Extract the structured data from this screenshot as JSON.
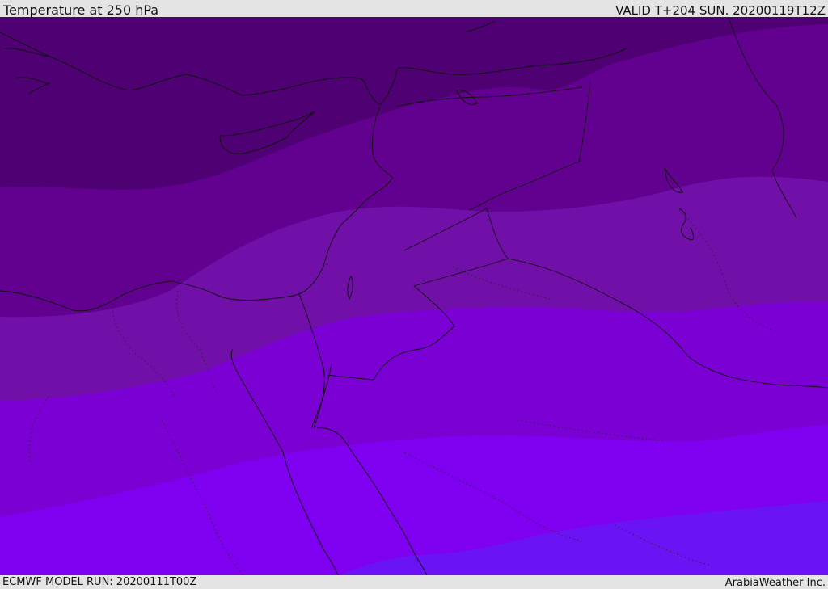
{
  "header": {
    "title": "Temperature at 250 hPa",
    "valid_time": "VALID T+204 SUN. 20200119T12Z"
  },
  "footer": {
    "model_run": "ECMWF MODEL RUN: 20200111T00Z",
    "credit": "ArabiaWeather Inc."
  },
  "map": {
    "parameter": "temperature",
    "level": "250 hPa",
    "band_colors": [
      "#4f0073",
      "#62008f",
      "#7010a8",
      "#7a00d4",
      "#7f00f0",
      "#6a14f5"
    ]
  }
}
